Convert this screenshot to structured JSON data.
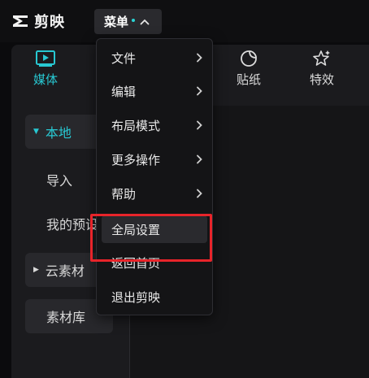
{
  "app": {
    "name": "剪映"
  },
  "menu_button": {
    "label": "菜单"
  },
  "toolbar": {
    "items": [
      {
        "label": "媒体",
        "active": true,
        "icon": "media-icon"
      },
      {
        "label": "贴纸",
        "active": false,
        "icon": "sticker-icon"
      },
      {
        "label": "特效",
        "active": false,
        "icon": "effects-icon"
      }
    ]
  },
  "sidebar": {
    "items": [
      {
        "label": "本地",
        "expanded": true,
        "active": true
      },
      {
        "label": "导入"
      },
      {
        "label": "我的预设"
      },
      {
        "label": "云素材",
        "expanded": false
      },
      {
        "label": "素材库"
      }
    ]
  },
  "dropdown": {
    "items": [
      {
        "label": "文件",
        "submenu": true
      },
      {
        "label": "编辑",
        "submenu": true
      },
      {
        "label": "布局模式",
        "submenu": true
      },
      {
        "label": "更多操作",
        "submenu": true
      },
      {
        "label": "帮助",
        "submenu": true
      },
      {
        "label": "全局设置",
        "submenu": false,
        "hovered": true
      },
      {
        "label": "返回首页",
        "submenu": false
      },
      {
        "label": "退出剪映",
        "submenu": false
      }
    ]
  },
  "colors": {
    "accent": "#28c8d2",
    "highlight_box": "#e8242a",
    "background": "#0b0b0d"
  }
}
